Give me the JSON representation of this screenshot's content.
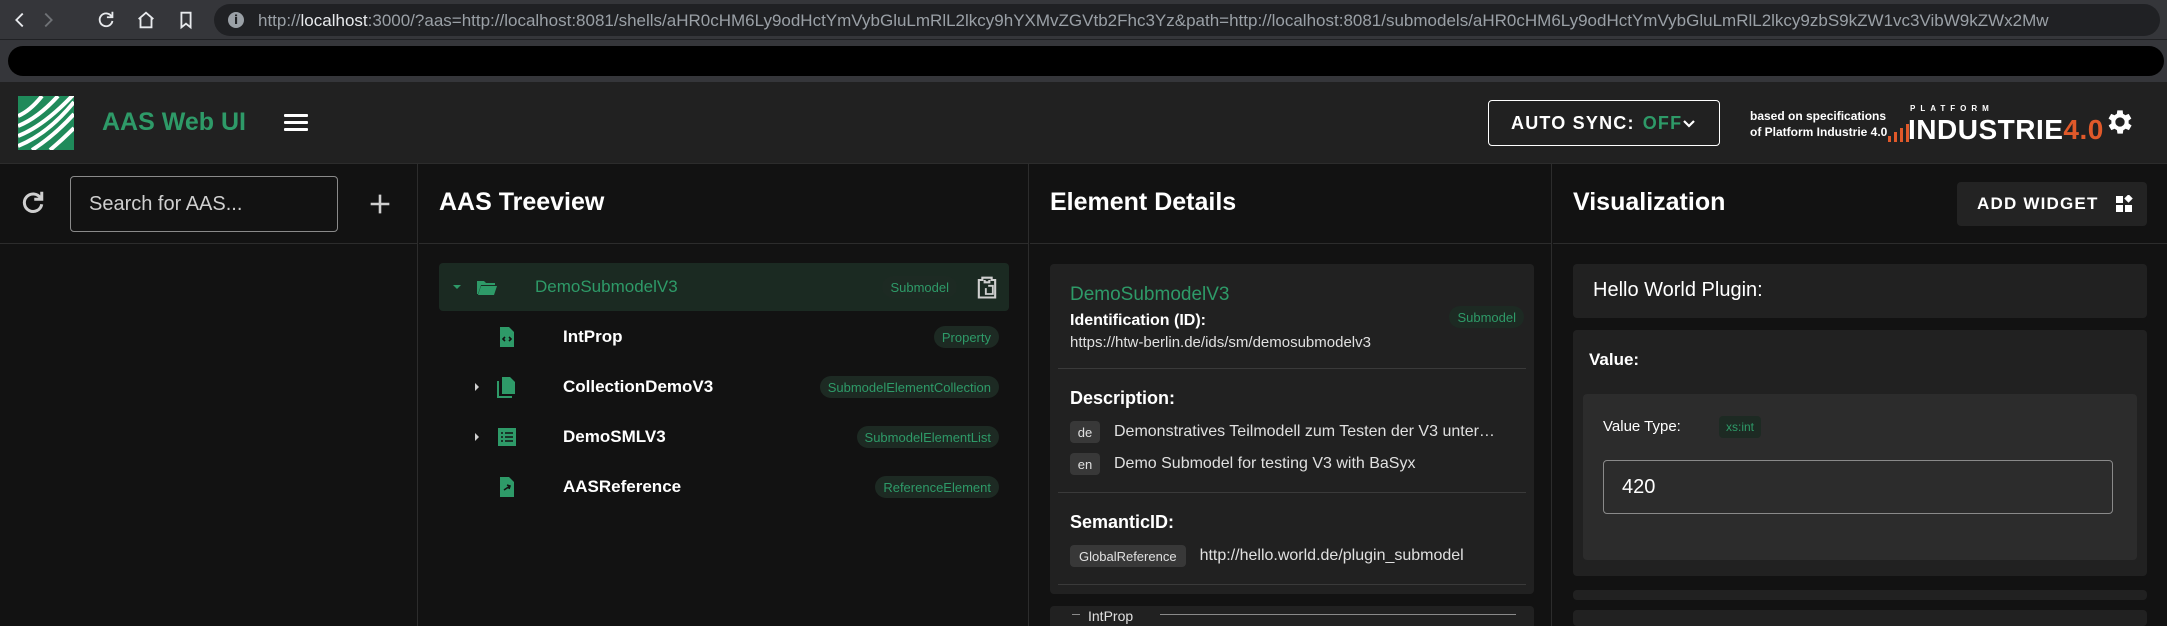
{
  "browser": {
    "url_prefix": "http://",
    "url_host": "localhost",
    "url_rest": ":3000/?aas=http://localhost:8081/shells/aHR0cHM6Ly9odHctYmVybGluLmRlL2lkcy9hYXMvZGVtb2Fhc3Yz&path=http://localhost:8081/submodels/aHR0cHM6Ly9odHctYmVybGluLmRlL2lkcy9zbS9kZW1vc3VibW9kZWx2Mw"
  },
  "app_bar": {
    "title": "AAS Web UI",
    "auto_sync_label": "AUTO SYNC:",
    "auto_sync_state": "OFF",
    "spec_line1": "based on specifications",
    "spec_line2": "of Platform Industrie 4.0",
    "industrie_platform": "PLATFORM",
    "industrie_word": "INDUSTRIE",
    "industrie_version": "4.0"
  },
  "left_panel": {
    "search_placeholder": "Search for AAS..."
  },
  "treeview": {
    "title": "AAS Treeview",
    "items": [
      {
        "label": "DemoSubmodelV3",
        "type": "Submodel"
      },
      {
        "label": "IntProp",
        "type": "Property"
      },
      {
        "label": "CollectionDemoV3",
        "type": "SubmodelElementCollection"
      },
      {
        "label": "DemoSMLV3",
        "type": "SubmodelElementList"
      },
      {
        "label": "AASReference",
        "type": "ReferenceElement"
      }
    ]
  },
  "details": {
    "title": "Element Details",
    "element_name": "DemoSubmodelV3",
    "element_type": "Submodel",
    "id_label": "Identification (ID):",
    "id_value": "https://htw-berlin.de/ids/sm/demosubmodelv3",
    "description_label": "Description:",
    "descriptions": [
      {
        "lang": "de",
        "text": "Demonstratives Teilmodell zum Testen der V3 unter…"
      },
      {
        "lang": "en",
        "text": "Demo Submodel for testing V3 with BaSyx"
      }
    ],
    "semantic_label": "SemanticID:",
    "semantic_type": "GlobalReference",
    "semantic_value": "http://hello.world.de/plugin_submodel",
    "next_card_label": "IntProp"
  },
  "visualization": {
    "title": "Visualization",
    "add_widget_label": "ADD WIDGET",
    "plugin_title": "Hello World Plugin:",
    "value_label": "Value:",
    "value_type_label": "Value Type:",
    "value_type": "xs:int",
    "value": "420"
  },
  "colors": {
    "accent": "#2e9a68",
    "background": "#121212",
    "surface": "#212121",
    "industrie_orange": "#e0592a"
  }
}
